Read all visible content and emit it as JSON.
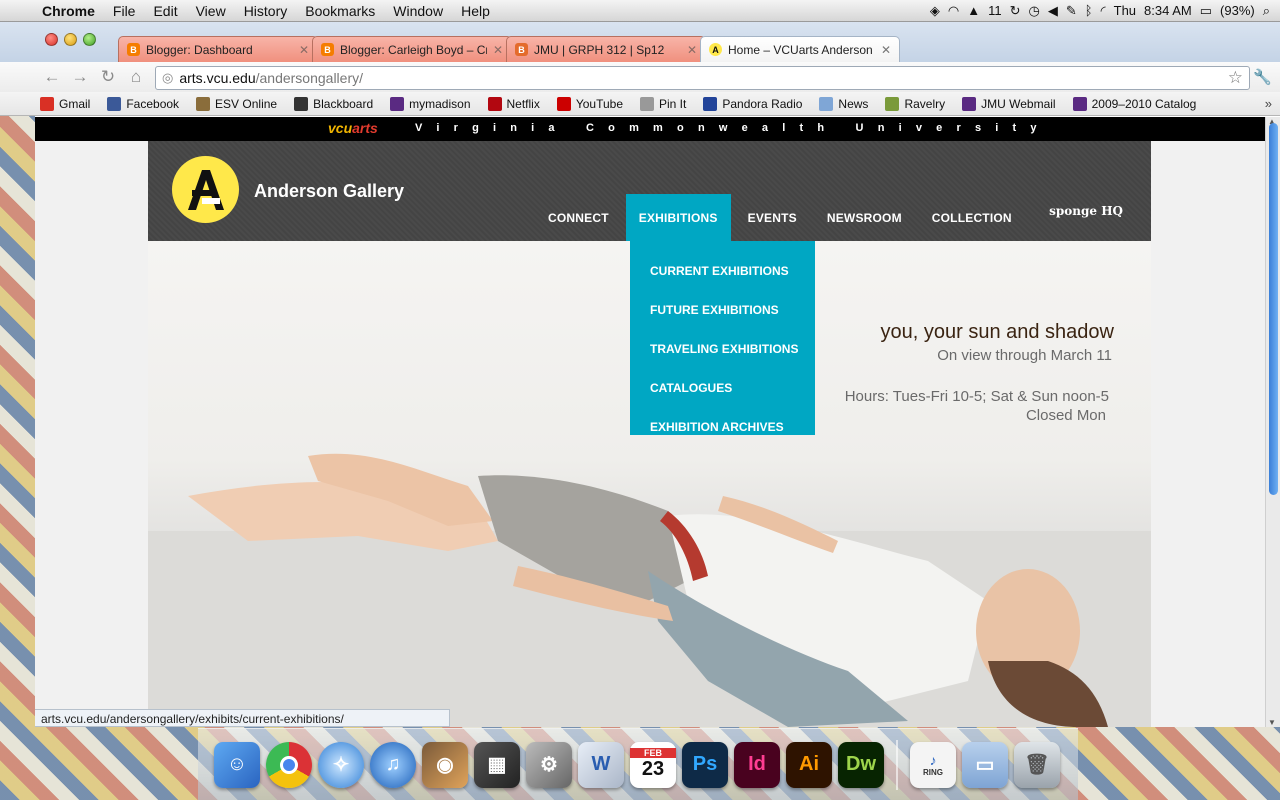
{
  "menubar": {
    "app": "Chrome",
    "items": [
      "File",
      "Edit",
      "View",
      "History",
      "Bookmarks",
      "Window",
      "Help"
    ],
    "notifications_count": "11",
    "day": "Thu",
    "time": "8:34 AM",
    "battery": "(93%)"
  },
  "browser": {
    "tabs": [
      {
        "label": "Blogger: Dashboard",
        "icon": "blogger-icon"
      },
      {
        "label": "Blogger: Carleigh Boyd – Cre",
        "icon": "blogger-icon"
      },
      {
        "label": "JMU | GRPH 312 | Sp12",
        "icon": "jmu-icon"
      },
      {
        "label": "Home – VCUarts Anderson G",
        "icon": "vcu-icon"
      }
    ],
    "url_host": "arts.vcu.edu",
    "url_path": "/andersongallery/",
    "bookmarks": [
      {
        "label": "Gmail",
        "icon": "gmail-icon",
        "color": "#d93025"
      },
      {
        "label": "Facebook",
        "icon": "facebook-icon",
        "color": "#3b5998"
      },
      {
        "label": "ESV Online",
        "icon": "esv-icon",
        "color": "#8a6d3b"
      },
      {
        "label": "Blackboard",
        "icon": "blackboard-icon",
        "color": "#333333"
      },
      {
        "label": "mymadison",
        "icon": "jmu-icon",
        "color": "#5a2a82"
      },
      {
        "label": "Netflix",
        "icon": "netflix-icon",
        "color": "#b20710"
      },
      {
        "label": "YouTube",
        "icon": "youtube-icon",
        "color": "#cc0000"
      },
      {
        "label": "Pin It",
        "icon": "pinit-icon",
        "color": "#999999"
      },
      {
        "label": "Pandora Radio",
        "icon": "pandora-icon",
        "color": "#224499"
      },
      {
        "label": "News",
        "icon": "folder-icon",
        "color": "#7fa6d6"
      },
      {
        "label": "Ravelry",
        "icon": "ravelry-icon",
        "color": "#7a9a3a"
      },
      {
        "label": "JMU Webmail",
        "icon": "jmu-icon",
        "color": "#5a2a82"
      },
      {
        "label": "2009–2010 Catalog",
        "icon": "jmu-icon",
        "color": "#5a2a82"
      }
    ],
    "status_url": "arts.vcu.edu/andersongallery/exhibits/current-exhibitions/"
  },
  "site": {
    "vcu_logo_a": "vcu",
    "vcu_logo_b": "arts",
    "university": "Virginia Commonwealth University",
    "title": "Anderson Gallery",
    "nav": [
      "CONNECT",
      "EXHIBITIONS",
      "EVENTS",
      "NEWSROOM",
      "COLLECTION"
    ],
    "sponge": "sponge HQ",
    "dropdown": [
      "CURRENT EXHIBITIONS",
      "FUTURE EXHIBITIONS",
      "TRAVELING EXHIBITIONS",
      "CATALOGUES",
      "EXHIBITION ARCHIVES"
    ],
    "show_title": "you, your sun and shadow",
    "show_dates": "On view through March 11",
    "hours": "Hours: Tues-Fri 10-5; Sat & Sun noon-5",
    "closed": "Closed Mon",
    "accent_color": "#00a7c3"
  },
  "dock": {
    "calendar_month": "FEB",
    "calendar_day": "23",
    "apps": [
      "Finder",
      "Chrome",
      "Safari",
      "iTunes",
      "iPhoto",
      "Photo Booth",
      "System Preferences",
      "Microsoft Word",
      "iCal",
      "Photoshop",
      "InDesign",
      "Illustrator",
      "Dreamweaver"
    ],
    "ps": "Ps",
    "id": "Id",
    "ai": "Ai",
    "dw": "Dw",
    "ring_label": "RING"
  }
}
